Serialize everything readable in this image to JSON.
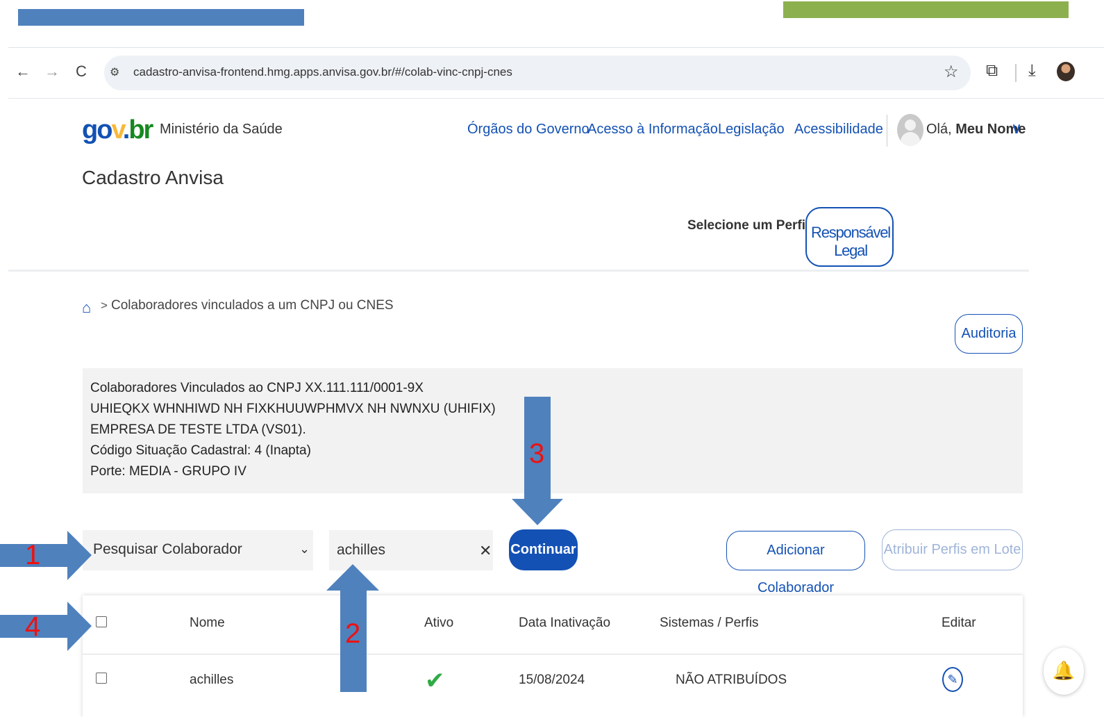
{
  "browser": {
    "url": "cadastro-anvisa-frontend.hmg.apps.anvisa.gov.br/#/colab-vinc-cnpj-cnes"
  },
  "header": {
    "logo_parts": [
      "go",
      "v",
      ".",
      "br"
    ],
    "ministry": "Ministério da Saúde",
    "links": [
      "Órgãos do Governo",
      "Acesso à Informação",
      "Legislação",
      "Acessibilidade"
    ],
    "greeting_prefix": "Olá,",
    "user_name": "Meu Nome",
    "app_title": "Cadastro Anvisa",
    "profile_label": "Selecione um Perfil:",
    "profile_value": "Responsável Legal"
  },
  "breadcrumb": {
    "separator": ">",
    "current": "Colaboradores vinculados a um CNPJ ou CNES"
  },
  "actions": {
    "audit": "Auditoria",
    "continue": "Continuar",
    "add_collaborator": "Adicionar Colaborador",
    "batch_profiles": "Atribuir Perfis em Lote"
  },
  "info": {
    "lines": [
      "Colaboradores Vinculados ao CNPJ XX.111.111/0001-9X",
      "UHIEQKX WHNHIWD NH FIXKHUUWPHMVX NH NWNXU (UHIFIX)",
      "EMPRESA DE TESTE LTDA (VS01).",
      "Código Situação Cadastral: 4 (Inapta)",
      "Porte: MEDIA - GRUPO IV"
    ]
  },
  "search": {
    "type_selected": "Pesquisar Colaborador",
    "query": "achilles"
  },
  "table": {
    "columns": [
      "Nome",
      "Ativo",
      "Data Inativação",
      "Sistemas / Perfis",
      "Editar"
    ],
    "rows": [
      {
        "nome": "achilles",
        "ativo": true,
        "data_inativacao": "15/08/2024",
        "sistemas_perfis": "NÃO ATRIBUÍDOS"
      }
    ]
  },
  "annotations": {
    "labels": [
      "1",
      "2",
      "3",
      "4"
    ],
    "arrow_color": "#4f81bd",
    "number_color": "#ee1111"
  },
  "colors": {
    "primary": "#1351b4",
    "top_bar_blue": "#4f81bd",
    "top_bar_green": "#8db04e",
    "success": "#2eab45"
  }
}
